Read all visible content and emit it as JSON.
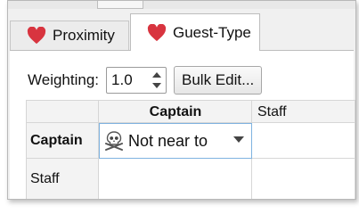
{
  "tabs": [
    {
      "label": "Proximity",
      "icon": "heart-icon",
      "active": false
    },
    {
      "label": "Guest-Type",
      "icon": "heart-icon",
      "active": true
    }
  ],
  "weighting": {
    "label": "Weighting:",
    "value": "1.0"
  },
  "bulk_edit_label": "Bulk Edit...",
  "grid": {
    "column_headers": [
      "Captain",
      "Staff"
    ],
    "row_headers": [
      "Captain",
      "Staff"
    ],
    "cells": [
      [
        "Not near to",
        ""
      ],
      [
        "",
        ""
      ]
    ],
    "cell_icon": "skull-crossbones-icon"
  },
  "colors": {
    "heart": "#d8343f",
    "selection_border": "#7fb3e0"
  }
}
